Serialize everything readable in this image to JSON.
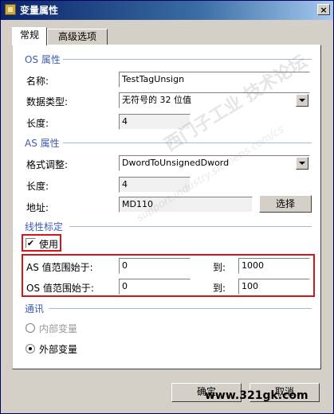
{
  "window": {
    "title": "变量属性",
    "close": "×"
  },
  "tabs": [
    {
      "label": "常规"
    },
    {
      "label": "高级选项"
    }
  ],
  "os_section": {
    "title": "OS 属性",
    "name_label": "名称:",
    "name_value": "TestTagUnsign",
    "datatype_label": "数据类型:",
    "datatype_value": "无符号的 32 位值",
    "length_label": "长度:",
    "length_value": "4"
  },
  "as_section": {
    "title": "AS 属性",
    "format_label": "格式调整:",
    "format_value": "DwordToUnsignedDword",
    "length_label": "长度:",
    "length_value": "4",
    "address_label": "地址:",
    "address_value": "MD110",
    "select_button": "选择"
  },
  "linear": {
    "title": "线性标定",
    "use_label": "使用",
    "use_checked": true,
    "check_mark": "✔",
    "as_from_label": "AS 值范围始于:",
    "as_from_value": "0",
    "as_to_label": "到:",
    "as_to_value": "1000",
    "os_from_label": "OS 值范围始于:",
    "os_from_value": "0",
    "os_to_label": "到:",
    "os_to_value": "100"
  },
  "comm": {
    "title": "通讯",
    "internal_label": "内部变量",
    "external_label": "外部变量",
    "selected": "external"
  },
  "buttons": {
    "ok": "确定",
    "cancel": "取消"
  },
  "watermarks": {
    "cn": "西门子工业 技术论坛",
    "en": "support.industry.siemens.com/cs",
    "site": "www.321gk.com"
  },
  "colors": {
    "highlight": "#d01818",
    "section_title": "#3c5cb0"
  }
}
